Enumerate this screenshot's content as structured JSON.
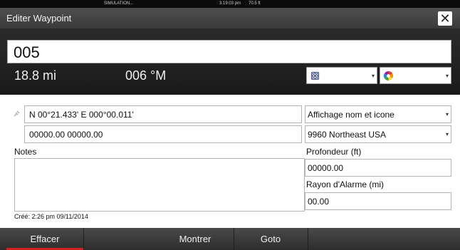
{
  "status_bar": {
    "mode": "SIMULATION...",
    "clock": "3:19:03 pm",
    "depth": "70.5 ft"
  },
  "window": {
    "title": "Editer Waypoint",
    "close_icon": "close-x-icon"
  },
  "waypoint": {
    "name": "005",
    "distance": "18.8 mi",
    "bearing": "006 °M",
    "symbol_icon": "waypoint-symbol-icon",
    "color_icon": "color-wheel-icon"
  },
  "position": {
    "coordinates": "N 00°21.433'   E 000°00.011'",
    "alt_coordinates": "00000.00  00000.00",
    "location_icon": "satellite-icon"
  },
  "display": {
    "mode": "Affichage nom et icone",
    "chart_region": "9960 Northeast USA"
  },
  "notes": {
    "label": "Notes",
    "value": ""
  },
  "depth": {
    "label": "Profondeur (ft)",
    "value": "00000.00"
  },
  "alarm": {
    "label": "Rayon d'Alarme (mi)",
    "value": "00.00"
  },
  "created": "Créé: 2:26 pm  09/11/2014",
  "actions": {
    "delete": "Effacer",
    "show": "Montrer",
    "goto": "Goto"
  },
  "colors": {
    "accent": "#d21f1f"
  }
}
